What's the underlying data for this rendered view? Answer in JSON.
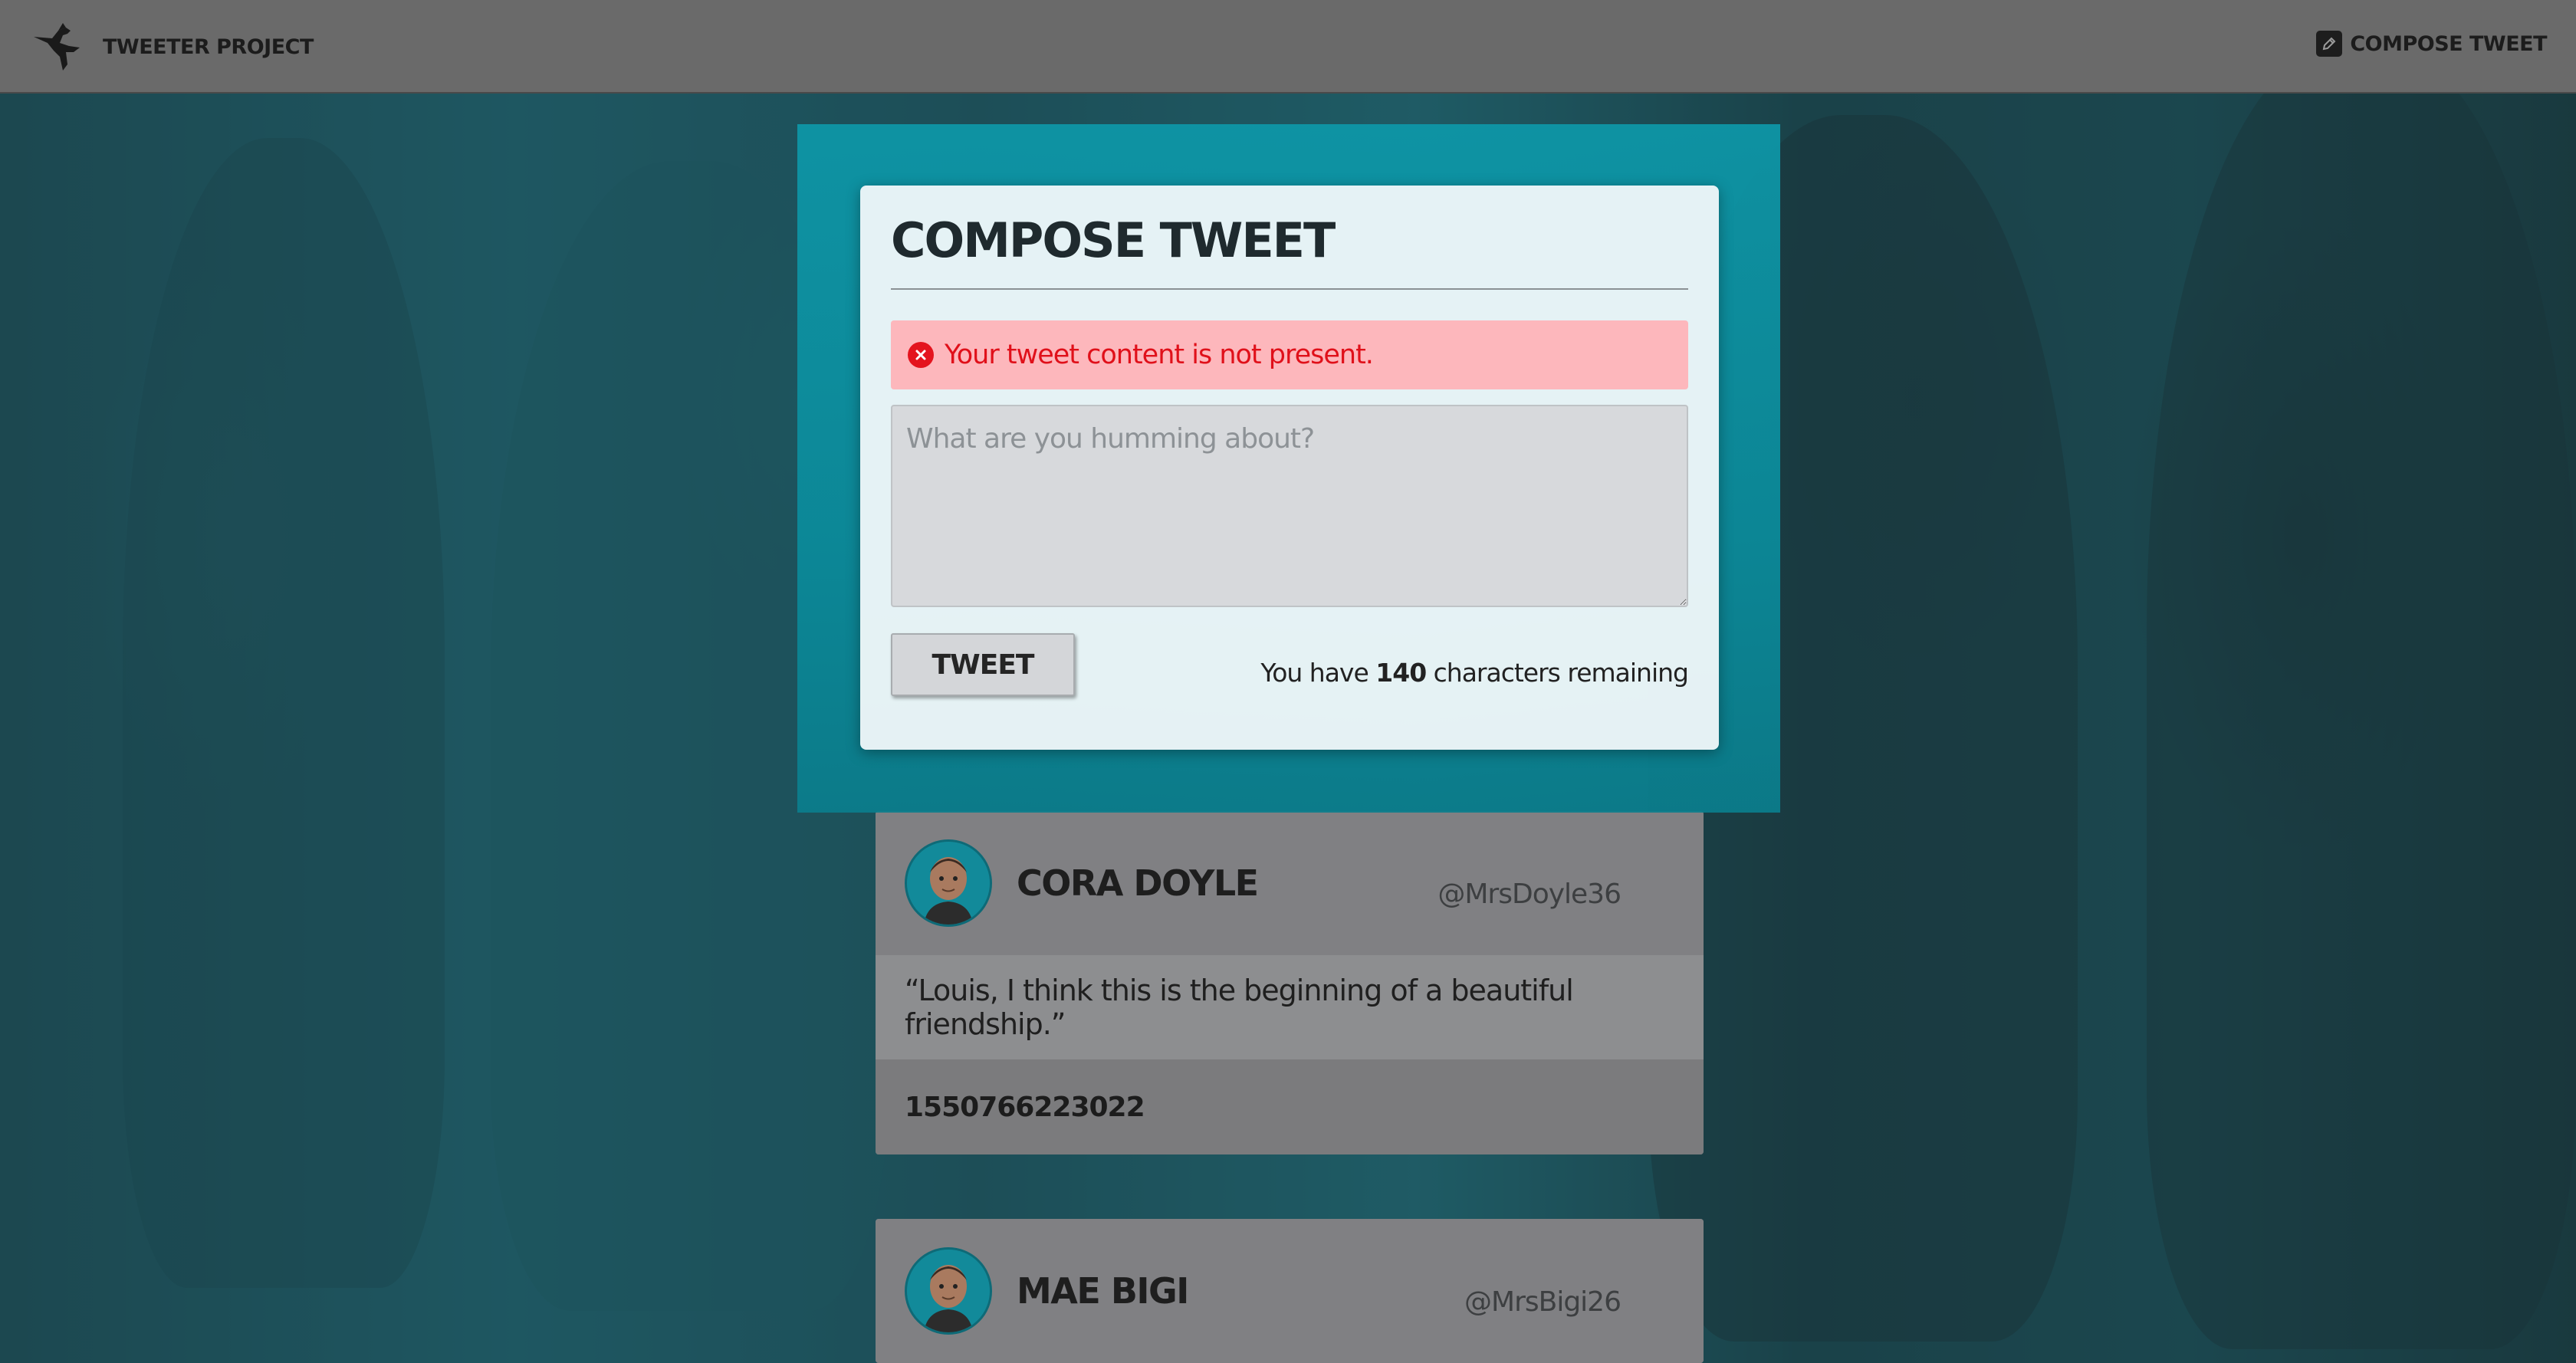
{
  "navbar": {
    "brand": "TWEETER PROJECT",
    "brand_icon": "hummingbird-icon",
    "compose_label": "COMPOSE TWEET",
    "compose_icon": "pencil-icon"
  },
  "modal": {
    "title": "COMPOSE TWEET",
    "error": "Your tweet content is not present.",
    "error_icon": "error-circle-icon",
    "input_placeholder": "What are you humming about?",
    "input_value": "",
    "button_label": "TWEET",
    "counter_prefix": "You have",
    "counter_value": "140",
    "counter_suffix": "characters remaining"
  },
  "tweets": [
    {
      "name": "CORA DOYLE",
      "handle": "@MrsDoyle36",
      "text": "“Louis, I think this is the beginning of a beautiful friendship.”",
      "timestamp": "1550766223022"
    },
    {
      "name": "MAE BIGI",
      "handle": "@MrsBigi26"
    }
  ],
  "colors": {
    "accent_teal": "#0d98a9",
    "error_text": "#e0101a",
    "error_bg": "#fdb7bc"
  }
}
